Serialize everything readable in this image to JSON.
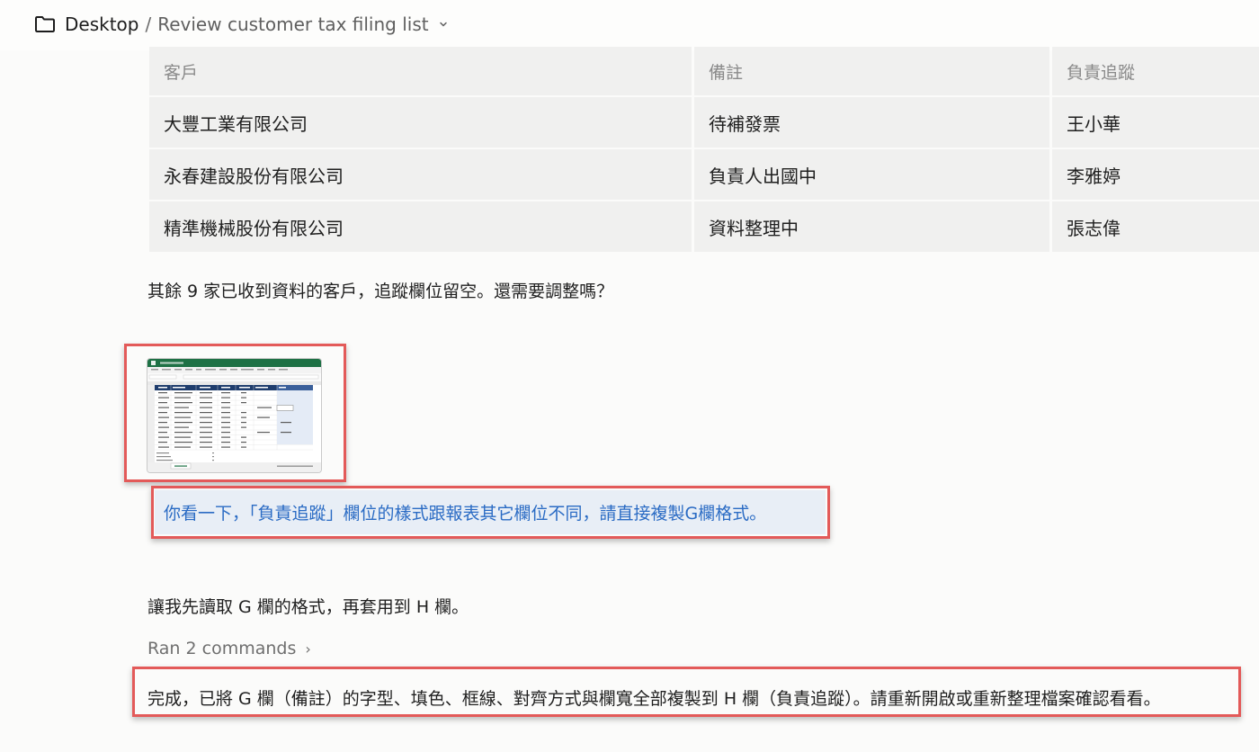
{
  "breadcrumb": {
    "root": "Desktop",
    "separator": "/",
    "current": "Review customer tax filing list"
  },
  "table": {
    "headers": [
      "客戶",
      "備註",
      "負責追蹤"
    ],
    "rows": [
      [
        "大豐工業有限公司",
        "待補發票",
        "王小華"
      ],
      [
        "永春建設股份有限公司",
        "負責人出國中",
        "李雅婷"
      ],
      [
        "精準機械股份有限公司",
        "資料整理中",
        "張志偉"
      ]
    ]
  },
  "messages": {
    "assistant_1": "其餘 9 家已收到資料的客戶，追蹤欄位留空。還需要調整嗎？",
    "user_1": "你看一下，「負責追蹤」欄位的樣式跟報表其它欄位不同，請直接複製G欄格式。",
    "assistant_2": "讓我先讀取 G 欄的格式，再套用到 H 欄。",
    "ran_commands": "Ran 2 commands",
    "assistant_3": "完成，已將 G 欄（備註）的字型、填色、框線、對齊方式與欄寬全部複製到 H 欄（負責追蹤）。請重新開啟或重新整理檔案確認看看。"
  },
  "icons": {
    "breadcrumb": "folder-icon",
    "breadcrumb_menu": "chevron-down-icon",
    "ran_commands": "chevron-right-icon"
  },
  "colors": {
    "highlight": "#e35a59",
    "user_text": "#2a6bc4",
    "user_bubble": "#e8eef6",
    "excel_green": "#1e7145"
  }
}
